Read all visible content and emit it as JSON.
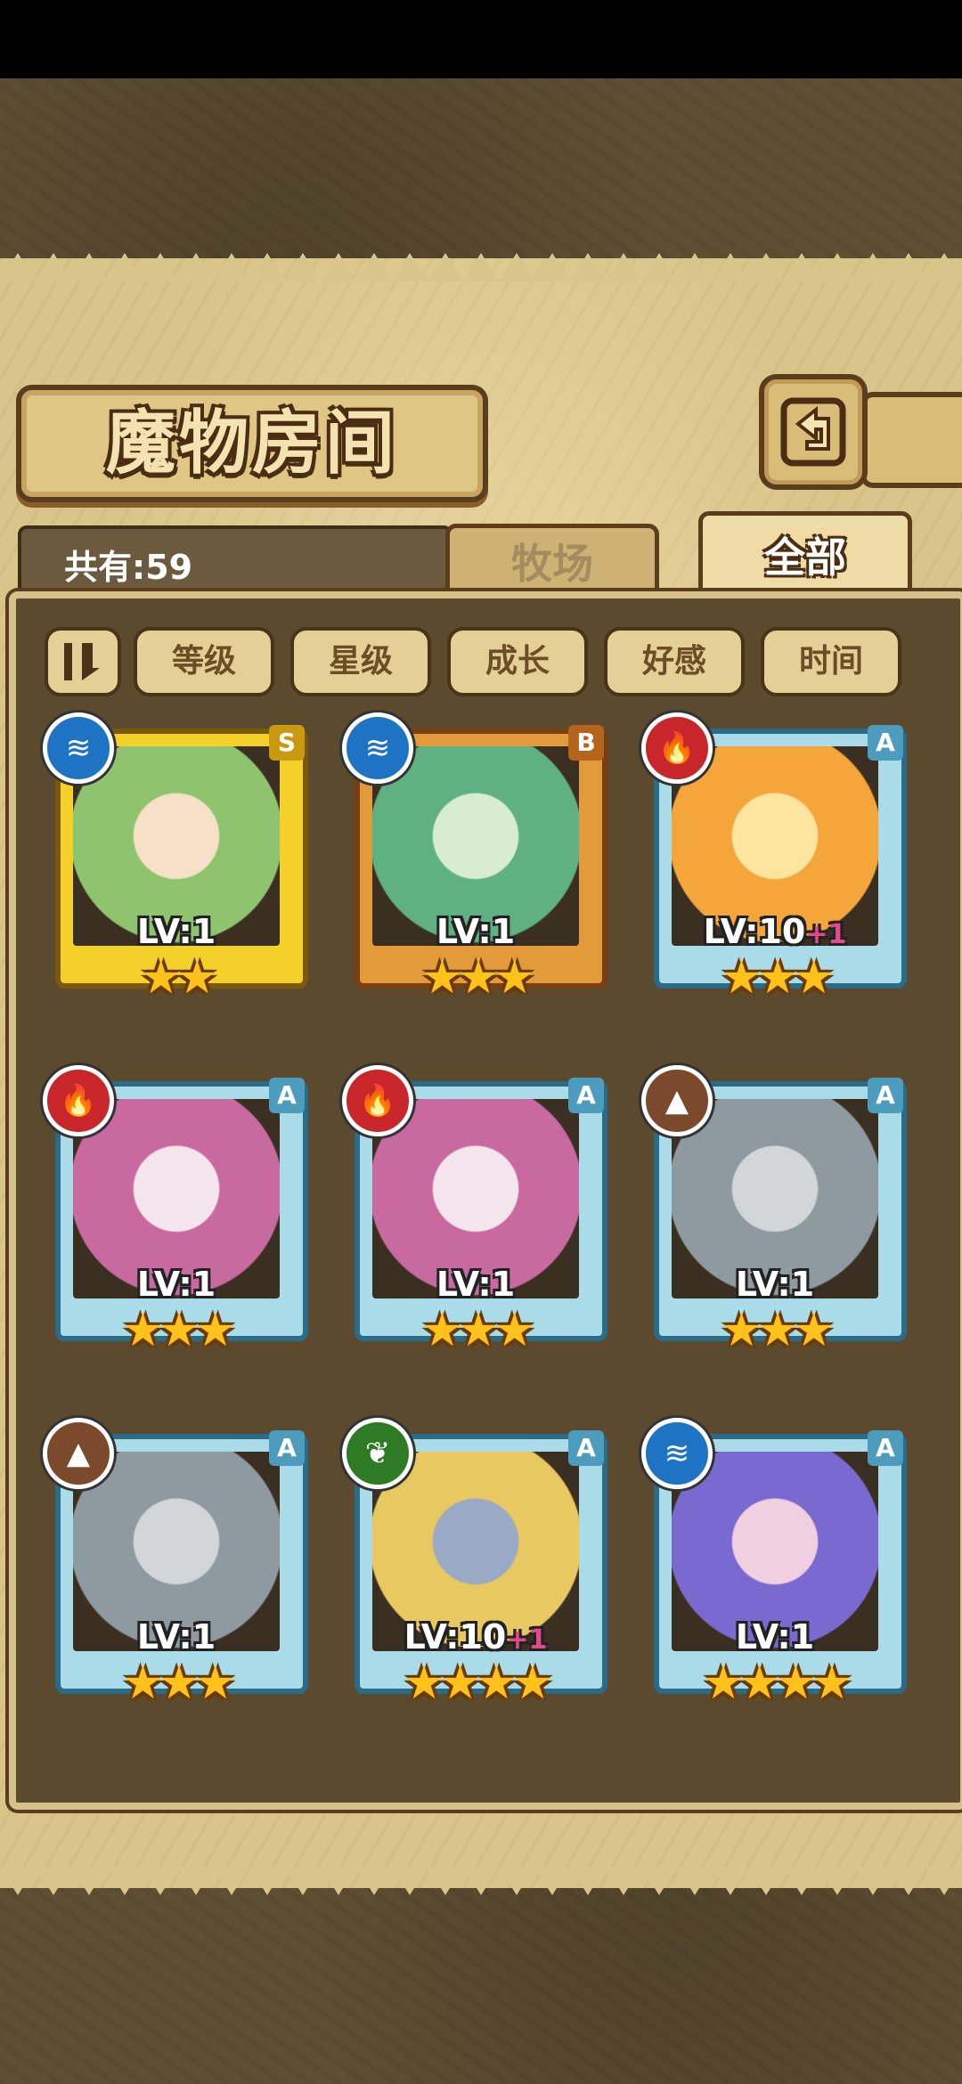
{
  "header": {
    "title": "魔物房间",
    "back_icon": "return-arrow-icon"
  },
  "collection": {
    "count_text": "共有:59"
  },
  "tabs": [
    {
      "label": "牧场",
      "active": false
    },
    {
      "label": "全部",
      "active": true
    }
  ],
  "sort": {
    "toggle_icon": "sort-order-icon",
    "buttons": [
      "等级",
      "星级",
      "成长",
      "好感",
      "时间"
    ]
  },
  "monsters": [
    {
      "element": "water",
      "rank": "S",
      "frame": "gold",
      "level": "LV:1",
      "bonus": "",
      "stars": 2,
      "portrait_colors": [
        "#8fc46f",
        "#f6e1c8"
      ]
    },
    {
      "element": "water",
      "rank": "B",
      "frame": "bronze",
      "level": "LV:1",
      "bonus": "",
      "stars": 3,
      "portrait_colors": [
        "#5fb083",
        "#d8ecd0"
      ]
    },
    {
      "element": "fire",
      "rank": "A",
      "frame": "blue",
      "level": "LV:10",
      "bonus": "+1",
      "stars": 3,
      "portrait_colors": [
        "#f4a63a",
        "#fde5a0"
      ]
    },
    {
      "element": "fire",
      "rank": "A",
      "frame": "blue",
      "level": "LV:1",
      "bonus": "",
      "stars": 3,
      "portrait_colors": [
        "#c86aa0",
        "#f4e6ec"
      ]
    },
    {
      "element": "fire",
      "rank": "A",
      "frame": "blue",
      "level": "LV:1",
      "bonus": "",
      "stars": 3,
      "portrait_colors": [
        "#c86aa0",
        "#f4e6ec"
      ]
    },
    {
      "element": "earth",
      "rank": "A",
      "frame": "blue",
      "level": "LV:1",
      "bonus": "",
      "stars": 3,
      "portrait_colors": [
        "#8e9aa0",
        "#d2d6d8"
      ]
    },
    {
      "element": "earth",
      "rank": "A",
      "frame": "blue",
      "level": "LV:1",
      "bonus": "",
      "stars": 3,
      "portrait_colors": [
        "#8e9aa0",
        "#d2d6d8"
      ]
    },
    {
      "element": "wood",
      "rank": "A",
      "frame": "blue",
      "level": "LV:10",
      "bonus": "+1",
      "stars": 4,
      "portrait_colors": [
        "#e8c860",
        "#9aa9c6"
      ]
    },
    {
      "element": "water",
      "rank": "A",
      "frame": "blue",
      "level": "LV:1",
      "bonus": "",
      "stars": 4,
      "portrait_colors": [
        "#7a6ad0",
        "#f0d0e0"
      ]
    }
  ],
  "colors": {
    "accent_gold": "#f4d02a",
    "panel": "#5b4a2e",
    "parchment": "#d9c48a"
  }
}
